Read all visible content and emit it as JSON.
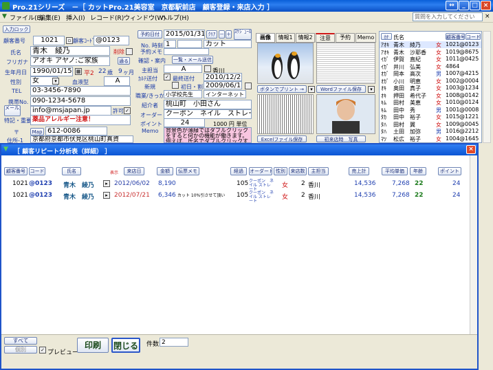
{
  "window": {
    "title": "Pro.21シリーズ　－［ カットPro.21美容室　京都駅前店　顧客登録・来店入力 ］"
  },
  "menu": [
    "ファイル(E)",
    "編集(E)",
    "挿入(I)",
    "レコード(R)",
    "ウィンドウ(W)",
    "ヘルプ(H)"
  ],
  "search": {
    "placeholder": "質問を入力してください"
  },
  "customer": {
    "input_lock": "入力ロック",
    "id_label": "顧客番号",
    "id": "1021",
    "code_label": "顧客ｺｰﾄﾞ",
    "code": "@0123",
    "name_label": "氏名",
    "name": "青木　綾乃",
    "delete_label": "削除",
    "kana_label": "フリガナ",
    "kana": "アオキ アヤノ:ご家族",
    "notify_label": "通る",
    "birth_label": "生年月日",
    "birth": "1990/01/15",
    "era": "平2",
    "age": "22",
    "age_unit": "歳",
    "month": "9",
    "month_unit": "ヶ月",
    "gender_label": "性別",
    "gender": "女",
    "blood_label": "血液型",
    "blood": "A",
    "tel_label": "TEL",
    "tel": "03-3456-7890",
    "mobile_label": "携帯No.",
    "mobile": "090-1234-5678",
    "mail_label": "メール送信",
    "mail": "info@msjapan.jp",
    "permit_label": "許可",
    "note_label": "特記・重要",
    "note": "薬品アレルギー注意！",
    "zip_label": "〒",
    "map_label": "Map",
    "zip": "612-0086",
    "addr_label": "住所-1",
    "addr": "京都府京都市伏見区桃山町真資"
  },
  "visit": {
    "date_btn": "予約日付",
    "date": "2015/01/31",
    "clear": "ｸﾘｱ",
    "minus": "－",
    "plus": "＋",
    "sched": "ｽｹｼﾞｭｰﾙ 全体",
    "time_label": "No. 時刻",
    "num": "1",
    "menu": "カット",
    "memo_label": "予約メモ",
    "confirm_label": "確認・案内",
    "list_btn": "一覧・メール送信",
    "staff_label": "主担当",
    "staff": "A",
    "staff_name": "香川",
    "karte_label": "ｶﾙﾃ送付",
    "last_label": "最終送付",
    "last": "2010/12/20",
    "new_label": "新規",
    "first_label": "初日・割引",
    "first": "2009/06/10",
    "channel_label": "職業/きっかけ",
    "channel1": "小学校先生",
    "channel2": "インターネット",
    "intro_label": "紹介者",
    "intro": "桃山町　小田さん",
    "order_label": "オーダード",
    "order": "クーポン　ネイル　ストレート",
    "point_label": "ポイント",
    "point": "24",
    "point_rate": "1000 円 単位",
    "memo_label2": "Memo",
    "memo": "背景色が薄緑ではダブルクリックをすると何かの機能が働きます。例えば、氏名でダブルクリックする"
  },
  "tabs": [
    "画像",
    "情報1",
    "情報2",
    "注意",
    "予約",
    "Memo"
  ],
  "images": {
    "print_btn": "ボタンでプリント →",
    "word_btn": "Wordファイル保存",
    "excel_btn": "Excelファイル保存",
    "first_visit": "初来店時　写真"
  },
  "list": {
    "header": {
      "kana": "ｶﾅ",
      "name": "氏名",
      "id": "顧客番号",
      "code": "コード"
    },
    "rows": [
      {
        "kana": "ｱｵｷ",
        "name": "青木　綾乃",
        "sex": "女",
        "id": "1021",
        "code": "@0123"
      },
      {
        "kana": "ｱｵｷ",
        "name": "青木　沙耶香",
        "sex": "女",
        "id": "1019",
        "code": "@8675"
      },
      {
        "kana": "ｲｶﾞ",
        "name": "伊賀　直紀",
        "sex": "女",
        "id": "1011",
        "code": "@0425"
      },
      {
        "kana": "ｲｶﾞ",
        "name": "井川　弘美",
        "sex": "女",
        "id": "4864",
        "code": ""
      },
      {
        "kana": "ｵｶﾞ",
        "name": "岡本　高次",
        "sex": "男",
        "id": "1007",
        "code": "@4215"
      },
      {
        "kana": "ｵｶﾞ",
        "name": "小川　明恵",
        "sex": "女",
        "id": "1002",
        "code": "@0004"
      },
      {
        "kana": "ｵｷ",
        "name": "奥田　真子",
        "sex": "女",
        "id": "1003",
        "code": "@1234"
      },
      {
        "kana": "ｵｷ",
        "name": "押田　希代子",
        "sex": "女",
        "id": "1008",
        "code": "@0142"
      },
      {
        "kana": "ｷﾑ",
        "name": "田村　美恵",
        "sex": "女",
        "id": "1010",
        "code": "@0124"
      },
      {
        "kana": "ｷﾑ",
        "name": "田中　秀",
        "sex": "男",
        "id": "1001",
        "code": "@0008"
      },
      {
        "kana": "ﾀｶ",
        "name": "田中　裕子",
        "sex": "女",
        "id": "1015",
        "code": "@1221"
      },
      {
        "kana": "ﾀﾊ",
        "name": "田村　翼",
        "sex": "女",
        "id": "1009",
        "code": "@0045"
      },
      {
        "kana": "ﾀﾊ",
        "name": "土田　加弥",
        "sex": "男",
        "id": "1016",
        "code": "@2212"
      },
      {
        "kana": "ﾏﾂ",
        "name": "松広　裕子",
        "sex": "女",
        "id": "1004",
        "code": "@1645"
      }
    ]
  },
  "dialog": {
    "title": "［ 顧客リピート分析表（詳細） ］",
    "headers": {
      "id": "顧客番号",
      "code": "コード",
      "name": "氏名",
      "ev": "表示",
      "date": "来店日",
      "amount": "金額",
      "memo": "伝票メモ",
      "elapsed": "経過",
      "order": "オーダード",
      "sex": "性別",
      "visits": "来店数",
      "staff": "主担当",
      "total": "売上計",
      "avg": "平均単価",
      "age": "年齢",
      "point": "ポイント"
    },
    "rows": [
      {
        "id": "1021",
        "code": "@0123",
        "name": "青木　綾乃",
        "date": "2012/06/02",
        "amount": "8,190",
        "memo": "",
        "elapsed": "105",
        "order": "クーポン　ネイル ストレート",
        "sex": "女",
        "visits": "2",
        "staff": "香川",
        "total": "14,536",
        "avg": "7,268",
        "age": "22",
        "point": "24"
      },
      {
        "id": "1021",
        "code": "@0123",
        "name": "青木　綾乃",
        "date": "2012/07/21",
        "amount": "6,346",
        "memo": "カット 10%引させて頂い",
        "elapsed": "105",
        "order": "クーポン　ネイル ストレート",
        "sex": "女",
        "visits": "2",
        "staff": "香川",
        "total": "14,536",
        "avg": "7,268",
        "age": "22",
        "point": "24"
      }
    ],
    "bottom": {
      "all": "すべて",
      "single": "個別",
      "preview": "プレビュー",
      "print": "印刷",
      "close": "閉じる",
      "count_label": "件数",
      "count": "2"
    }
  },
  "colors": {
    "title": "#0a5fd8",
    "accent_red": "#d01818",
    "dialog_frame": "#1f54c9",
    "date_red": "#c83030",
    "date_blue": "#2a40a8"
  }
}
